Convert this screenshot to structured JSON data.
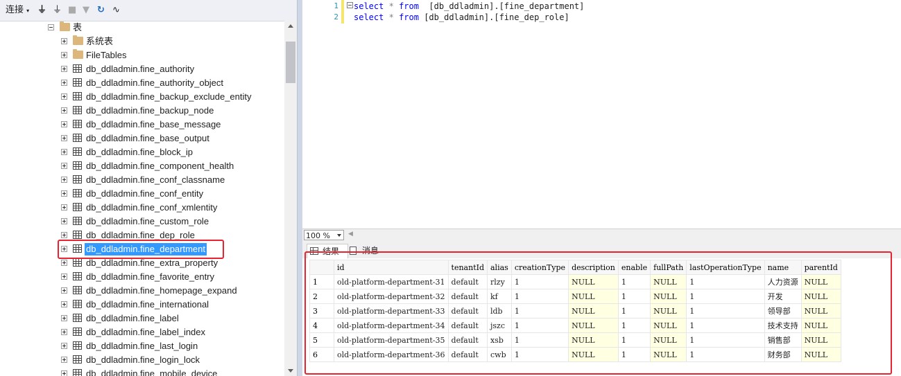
{
  "toolbar": {
    "connect_label": "连接",
    "icons": [
      "connect-icon",
      "disconnect-icon",
      "stop-icon",
      "filter-icon",
      "refresh-icon",
      "activity-icon"
    ]
  },
  "tree": {
    "tables_folder": "表",
    "system_tables": "系统表",
    "filetables": "FileTables",
    "items": [
      "db_ddladmin.fine_authority",
      "db_ddladmin.fine_authority_object",
      "db_ddladmin.fine_backup_exclude_entity",
      "db_ddladmin.fine_backup_node",
      "db_ddladmin.fine_base_message",
      "db_ddladmin.fine_base_output",
      "db_ddladmin.fine_block_ip",
      "db_ddladmin.fine_component_health",
      "db_ddladmin.fine_conf_classname",
      "db_ddladmin.fine_conf_entity",
      "db_ddladmin.fine_conf_xmlentity",
      "db_ddladmin.fine_custom_role",
      "db_ddladmin.fine_dep_role",
      "db_ddladmin.fine_department",
      "db_ddladmin.fine_extra_property",
      "db_ddladmin.fine_favorite_entry",
      "db_ddladmin.fine_homepage_expand",
      "db_ddladmin.fine_international",
      "db_ddladmin.fine_label",
      "db_ddladmin.fine_label_index",
      "db_ddladmin.fine_last_login",
      "db_ddladmin.fine_login_lock",
      "db_ddladmin.fine_mobile_device"
    ],
    "selected": "db_ddladmin.fine_department"
  },
  "editor": {
    "lines": [
      {
        "num": "1",
        "kw1": "select",
        "star": "*",
        "kw2": "from",
        "rest": "  [db_ddladmin].[fine_department]"
      },
      {
        "num": "2",
        "kw1": "select",
        "star": "*",
        "kw2": "from",
        "rest": " [db_ddladmin].[fine_dep_role]"
      }
    ]
  },
  "zoom": "100 %",
  "tabs": {
    "results": "结果",
    "messages": "消息"
  },
  "results": {
    "columns": [
      "id",
      "tenantId",
      "alias",
      "creationType",
      "description",
      "enable",
      "fullPath",
      "lastOperationType",
      "name",
      "parentId"
    ],
    "rows": [
      [
        "1",
        "old-platform-department-31",
        "default",
        "rlzy",
        "1",
        "NULL",
        "1",
        "NULL",
        "1",
        "人力资源",
        "NULL"
      ],
      [
        "2",
        "old-platform-department-32",
        "default",
        "kf",
        "1",
        "NULL",
        "1",
        "NULL",
        "1",
        "开发",
        "NULL"
      ],
      [
        "3",
        "old-platform-department-33",
        "default",
        "ldb",
        "1",
        "NULL",
        "1",
        "NULL",
        "1",
        "领导部",
        "NULL"
      ],
      [
        "4",
        "old-platform-department-34",
        "default",
        "jszc",
        "1",
        "NULL",
        "1",
        "NULL",
        "1",
        "技术支持",
        "NULL"
      ],
      [
        "5",
        "old-platform-department-35",
        "default",
        "xsb",
        "1",
        "NULL",
        "1",
        "NULL",
        "1",
        "销售部",
        "NULL"
      ],
      [
        "6",
        "old-platform-department-36",
        "default",
        "cwb",
        "1",
        "NULL",
        "1",
        "NULL",
        "1",
        "财务部",
        "NULL"
      ]
    ]
  },
  "colors": {
    "highlight": "#e8232f",
    "selection": "#3399ff",
    "keyword": "#0000ff",
    "null_bg": "#ffffe1"
  }
}
